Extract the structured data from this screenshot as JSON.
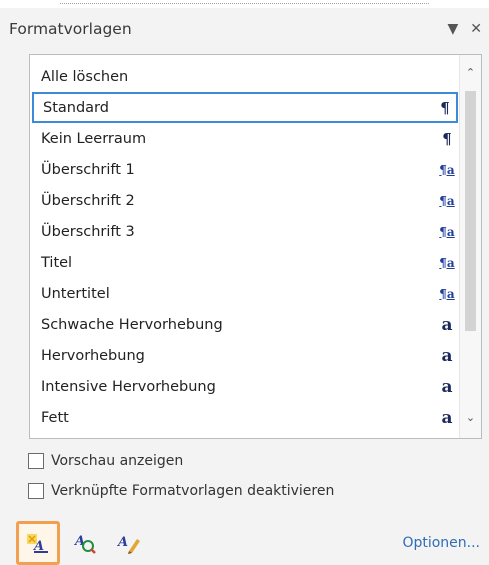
{
  "pane": {
    "title": "Formatvorlagen",
    "dropdown_glyph": "▼",
    "close_glyph": "✕"
  },
  "styles": [
    {
      "label": "Alle löschen",
      "type": "none",
      "selected": false
    },
    {
      "label": "Standard",
      "type": "paragraph",
      "selected": true
    },
    {
      "label": "Kein Leerraum",
      "type": "paragraph",
      "selected": false
    },
    {
      "label": "Überschrift 1",
      "type": "linked",
      "selected": false
    },
    {
      "label": "Überschrift 2",
      "type": "linked",
      "selected": false
    },
    {
      "label": "Überschrift 3",
      "type": "linked",
      "selected": false
    },
    {
      "label": "Titel",
      "type": "linked",
      "selected": false
    },
    {
      "label": "Untertitel",
      "type": "linked",
      "selected": false
    },
    {
      "label": "Schwache Hervorhebung",
      "type": "character",
      "selected": false
    },
    {
      "label": "Hervorhebung",
      "type": "character",
      "selected": false
    },
    {
      "label": "Intensive Hervorhebung",
      "type": "character",
      "selected": false
    },
    {
      "label": "Fett",
      "type": "character",
      "selected": false
    }
  ],
  "symbols": {
    "paragraph": "¶",
    "linked": "¶a",
    "character": "a"
  },
  "options": {
    "preview_label": "Vorschau anzeigen",
    "preview_checked": false,
    "disable_linked_label": "Verknüpfte Formatvorlagen deaktivieren",
    "disable_linked_checked": false
  },
  "toolbar": {
    "new_style_icon": "new-style-icon",
    "style_inspector_icon": "style-inspector-icon",
    "manage_styles_icon": "manage-styles-icon",
    "options_link": "Optionen..."
  },
  "colors": {
    "highlight": "#f0a050",
    "selection": "#3b8bd9",
    "link": "#2f6db5"
  }
}
